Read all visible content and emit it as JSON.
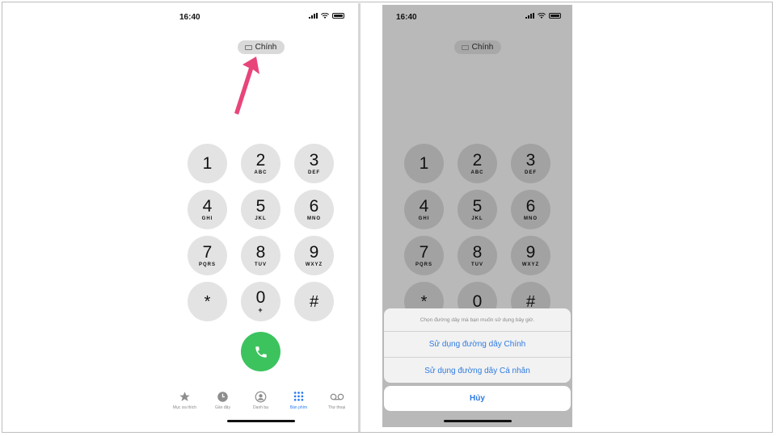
{
  "status": {
    "time": "16:40"
  },
  "line_pill": {
    "label": "Chính"
  },
  "keypad": [
    {
      "digit": "1",
      "letters": ""
    },
    {
      "digit": "2",
      "letters": "ABC"
    },
    {
      "digit": "3",
      "letters": "DEF"
    },
    {
      "digit": "4",
      "letters": "GHI"
    },
    {
      "digit": "5",
      "letters": "JKL"
    },
    {
      "digit": "6",
      "letters": "MNO"
    },
    {
      "digit": "7",
      "letters": "PQRS"
    },
    {
      "digit": "8",
      "letters": "TUV"
    },
    {
      "digit": "9",
      "letters": "WXYZ"
    },
    {
      "digit": "*",
      "letters": ""
    },
    {
      "digit": "0",
      "letters": "+"
    },
    {
      "digit": "#",
      "letters": ""
    }
  ],
  "tabs": [
    {
      "label": "Mục ưa thích",
      "icon": "star-icon"
    },
    {
      "label": "Gần đây",
      "icon": "clock-icon"
    },
    {
      "label": "Danh bạ",
      "icon": "contact-icon"
    },
    {
      "label": "Bàn phím",
      "icon": "keypad-icon",
      "active": true
    },
    {
      "label": "Thư thoại",
      "icon": "voicemail-icon"
    }
  ],
  "sheet": {
    "title": "Chọn đường dây mà bạn muốn sử dụng bây giờ.",
    "option_primary": "Sử dụng đường dây Chính",
    "option_personal": "Sử dụng đường dây Cá nhân",
    "cancel": "Hủy"
  },
  "colors": {
    "call_green": "#3cc35e",
    "accent_blue": "#2f7be0",
    "arrow_pink": "#e8457a"
  }
}
